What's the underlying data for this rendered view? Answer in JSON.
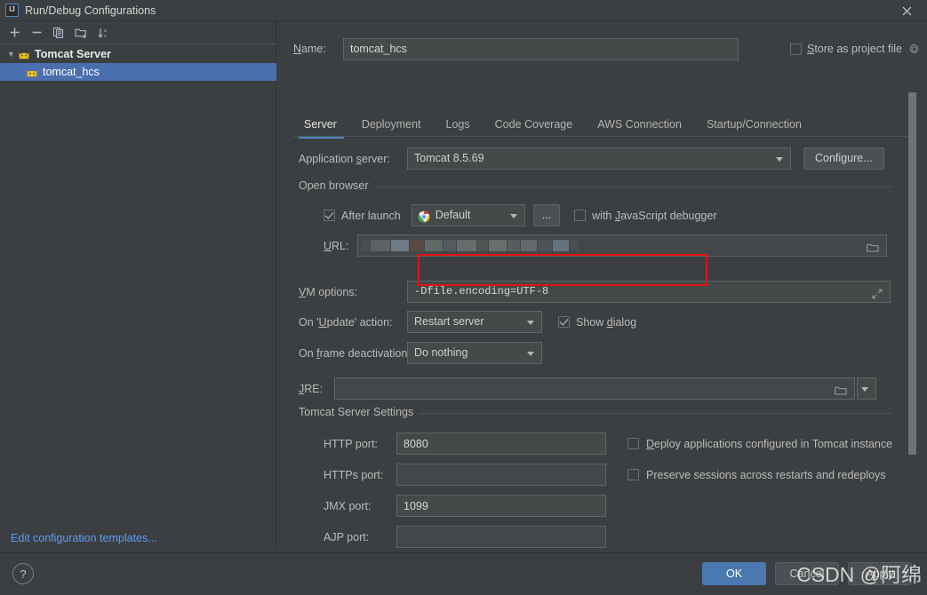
{
  "window": {
    "title": "Run/Debug Configurations",
    "app_icon": "intellij-idea-icon",
    "close_icon": "close-icon"
  },
  "left_panel": {
    "toolbar": [
      {
        "name": "add-configuration-button",
        "icon": "plus-icon",
        "tooltip": "Add New Configuration"
      },
      {
        "name": "remove-configuration-button",
        "icon": "minus-icon",
        "tooltip": "Remove Configuration"
      },
      {
        "name": "copy-configuration-button",
        "icon": "copy-icon",
        "tooltip": "Copy Configuration"
      },
      {
        "name": "save-configuration-button",
        "icon": "folder-add-icon",
        "tooltip": "Move into new folder"
      },
      {
        "name": "sort-configurations-button",
        "icon": "sort-alpha-icon",
        "tooltip": "Sort Configurations"
      }
    ],
    "tree": [
      {
        "label": "Tomcat Server",
        "icon": "tomcat-icon",
        "type": "group",
        "expanded": true,
        "selected": false
      },
      {
        "label": "tomcat_hcs",
        "icon": "tomcat-icon",
        "type": "item",
        "expanded": false,
        "selected": true
      }
    ],
    "edit_templates_link": "Edit configuration templates..."
  },
  "header": {
    "name_label": "Name:",
    "name_value": "tomcat_hcs",
    "store_as_project_file_label": "Store as project file",
    "store_as_project_file_checked": false,
    "gear_icon": "gear-icon"
  },
  "tabs": [
    {
      "label": "Server",
      "active": true
    },
    {
      "label": "Deployment",
      "active": false
    },
    {
      "label": "Logs",
      "active": false
    },
    {
      "label": "Code Coverage",
      "active": false
    },
    {
      "label": "AWS Connection",
      "active": false
    },
    {
      "label": "Startup/Connection",
      "active": false
    }
  ],
  "server_tab": {
    "application_server_label": "Application server:",
    "application_server_value": "Tomcat 8.5.69",
    "configure_button": "Configure...",
    "open_browser": {
      "group_title": "Open browser",
      "after_launch_label": "After launch",
      "after_launch_checked": true,
      "browser_value": "Default",
      "browser_icon": "chrome-icon",
      "browse_button_label": "...",
      "with_js_debugger_label": "with JavaScript debugger",
      "with_js_debugger_checked": false,
      "url_label": "URL:",
      "url_value": "",
      "url_redacted": true,
      "url_browse_icon": "folder-icon"
    },
    "vm_options_label": "VM options:",
    "vm_options_value": "-Dfile.encoding=UTF-8",
    "vm_options_expand_icon": "expand-icon",
    "vm_options_highlighted": true,
    "highlight_color": "#e50f0f",
    "on_update_action_label": "On 'Update' action:",
    "on_update_action_value": "Restart server",
    "show_dialog_label": "Show dialog",
    "show_dialog_checked": true,
    "on_frame_deactivation_label": "On frame deactivation:",
    "on_frame_deactivation_value": "Do nothing",
    "jre_label": "JRE:",
    "jre_value": "",
    "jre_browse_icon": "folder-icon",
    "jre_dropdown_icon": "chevron-down-icon",
    "tomcat_settings": {
      "group_title": "Tomcat Server Settings",
      "http_port_label": "HTTP port:",
      "http_port_value": "8080",
      "https_port_label": "HTTPs port:",
      "https_port_value": "",
      "jmx_port_label": "JMX port:",
      "jmx_port_value": "1099",
      "ajp_port_label": "AJP port:",
      "ajp_port_value": "",
      "deploy_applications_label": "Deploy applications configured in Tomcat instance",
      "deploy_applications_checked": false,
      "preserve_sessions_label": "Preserve sessions across restarts and redeploys",
      "preserve_sessions_checked": false
    }
  },
  "footer": {
    "help_label": "?",
    "ok_label": "OK",
    "cancel_label": "Cancel",
    "apply_label": "Apply"
  },
  "watermark": {
    "text": "CSDN @阿绵"
  },
  "colors": {
    "background": "#3c3f41",
    "field_background": "#45494a",
    "selection": "#4b6eaf",
    "accent": "#4a88c7",
    "link": "#589df6",
    "highlight": "#e50f0f",
    "primary_button": "#4a78b0"
  }
}
